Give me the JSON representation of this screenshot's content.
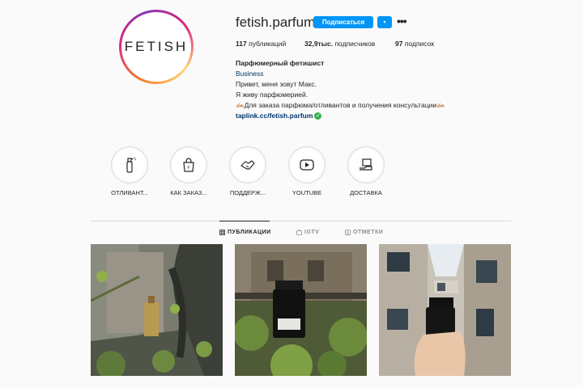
{
  "profile": {
    "username": "fetish.parfum",
    "avatar_text": "FETISH",
    "follow_label": "Подписаться",
    "dropdown_icon": "▾",
    "more_icon": "•••"
  },
  "stats": {
    "posts_count": "117",
    "posts_label": "публикаций",
    "followers_count": "32,9тыс.",
    "followers_label": "подписчиков",
    "following_count": "97",
    "following_label": "подписок"
  },
  "bio": {
    "name": "Парфюмерный фетишист",
    "category": "Business",
    "line1": "Привет, меня зовут Макс.",
    "line2": "Я живу парфюмерией.",
    "line3": "🫴🏼Для заказа парфюма/отливантов и получения консультации🫴🏼",
    "link": "taplink.cc/fetish.parfum"
  },
  "highlights": [
    {
      "label": "ОТЛИВАНТ...",
      "icon": "spray-bottle-icon"
    },
    {
      "label": "КАК ЗАКАЗ...",
      "icon": "shopping-bag-icon"
    },
    {
      "label": "ПОДДЕРЖ...",
      "icon": "handshake-icon"
    },
    {
      "label": "YOUTUBE",
      "icon": "youtube-icon"
    },
    {
      "label": "ДОСТАВКА",
      "icon": "delivery-box-icon"
    }
  ],
  "tabs": [
    {
      "label": "ПУБЛИКАЦИИ",
      "icon": "grid-icon",
      "active": true
    },
    {
      "label": "IGTV",
      "icon": "igtv-icon",
      "active": false
    },
    {
      "label": "ОТМЕТКИ",
      "icon": "tagged-icon",
      "active": false
    }
  ],
  "colors": {
    "accent": "#0095f6",
    "background": "#fafafa",
    "link": "#00376b",
    "verified": "#37b24d"
  }
}
